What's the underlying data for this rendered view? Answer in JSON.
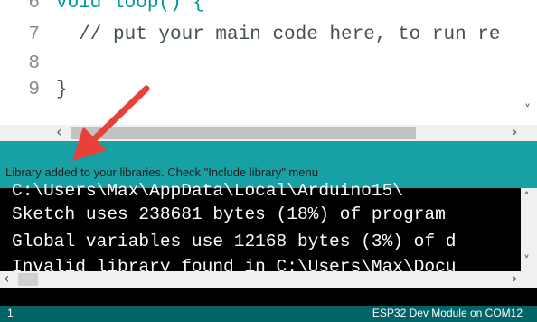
{
  "editor": {
    "lines": [
      {
        "number": "6",
        "text": "void loop() {"
      },
      {
        "number": "7",
        "text": "  // put your main code here, to run re"
      },
      {
        "number": "8",
        "text": ""
      },
      {
        "number": "9",
        "text": "}"
      }
    ]
  },
  "notice": {
    "message": "Library added to your libraries. Check \"Include library\" menu"
  },
  "console": {
    "lines": [
      "C:\\Users\\Max\\AppData\\Local\\Arduino15\\",
      "Sketch uses 238681 bytes (18%) of program",
      "Global variables use 12168 bytes (3%) of d",
      "Invalid library found in C:\\Users\\Max\\Docu"
    ]
  },
  "footer": {
    "line_number": "1",
    "board": "ESP32 Dev Module on COM12"
  },
  "icons": {
    "scroll_left": "‹",
    "scroll_right": "›",
    "scroll_up": "˄",
    "scroll_down": "˅"
  },
  "colors": {
    "notice_bar": "#17a1a5",
    "footer_bar": "#006468",
    "console_bg": "#000000",
    "annotation_arrow": "#e8413a"
  }
}
